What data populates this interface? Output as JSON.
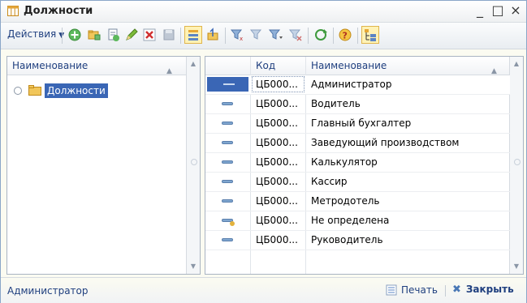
{
  "window": {
    "title": "Должности",
    "controls": [
      "_",
      "□",
      "×"
    ]
  },
  "toolbar": {
    "actions_label": "Действия",
    "buttons": [
      "add-icon",
      "add-copy-icon",
      "add-group-icon",
      "edit-icon",
      "delete-icon",
      "save-icon",
      "hierarchy-list-icon",
      "level-up-icon",
      "filter-icon",
      "filter-set-icon",
      "filter-menu-icon",
      "filter-clear-icon",
      "refresh-icon",
      "help-icon",
      "tree-view-icon"
    ]
  },
  "left_panel": {
    "header": "Наименование",
    "tree_items": [
      {
        "label": "Должности",
        "selected": true
      }
    ]
  },
  "table": {
    "columns": [
      "Код",
      "Наименование"
    ],
    "rows": [
      {
        "code": "ЦБ000...",
        "name": "Администратор",
        "selected": true,
        "icon": "element-icon"
      },
      {
        "code": "ЦБ000...",
        "name": "Водитель",
        "icon": "element-icon"
      },
      {
        "code": "ЦБ000...",
        "name": "Главный бухгалтер",
        "icon": "element-icon"
      },
      {
        "code": "ЦБ000...",
        "name": "Заведующий производством",
        "icon": "element-icon"
      },
      {
        "code": "ЦБ000...",
        "name": "Калькулятор",
        "icon": "element-icon"
      },
      {
        "code": "ЦБ000...",
        "name": "Кассир",
        "icon": "element-icon"
      },
      {
        "code": "ЦБ000...",
        "name": "Метродотель",
        "icon": "element-icon"
      },
      {
        "code": "ЦБ000...",
        "name": "Не определена",
        "icon": "predefined-element-icon"
      },
      {
        "code": "ЦБ000...",
        "name": "Руководитель",
        "icon": "element-icon"
      }
    ]
  },
  "statusbar": {
    "user": "Администратор",
    "print_label": "Печать",
    "close_label": "Закрыть"
  },
  "colors": {
    "accent": "#1f3f7f",
    "selection": "#3a66b5",
    "window_bg": "#fbfbf1"
  }
}
